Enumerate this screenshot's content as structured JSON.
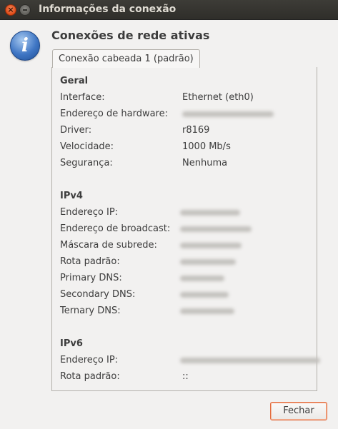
{
  "window": {
    "title": "Informações da conexão",
    "close_glyph": "×"
  },
  "info_icon_glyph": "i",
  "heading": "Conexões de rede ativas",
  "tab_label": "Conexão cabeada 1 (padrão)",
  "general": {
    "title": "Geral",
    "rows": [
      {
        "label": "Interface:",
        "value": "Ethernet (eth0)"
      },
      {
        "label": "Endereço de hardware:",
        "value": ""
      },
      {
        "label": "Driver:",
        "value": "r8169"
      },
      {
        "label": "Velocidade:",
        "value": "1000 Mb/s"
      },
      {
        "label": "Segurança:",
        "value": "Nenhuma"
      }
    ]
  },
  "ipv4": {
    "title": "IPv4",
    "rows": [
      {
        "label": "Endereço IP:",
        "value": ""
      },
      {
        "label": "Endereço de broadcast:",
        "value": ""
      },
      {
        "label": "Máscara de subrede:",
        "value": ""
      },
      {
        "label": "Rota padrão:",
        "value": ""
      },
      {
        "label": "Primary DNS:",
        "value": ""
      },
      {
        "label": "Secondary DNS:",
        "value": ""
      },
      {
        "label": "Ternary DNS:",
        "value": ""
      }
    ]
  },
  "ipv6": {
    "title": "IPv6",
    "rows": [
      {
        "label": "Endereço IP:",
        "value": ""
      },
      {
        "label": "Rota padrão:",
        "value": "::"
      }
    ]
  },
  "buttons": {
    "close_label": "Fechar"
  }
}
